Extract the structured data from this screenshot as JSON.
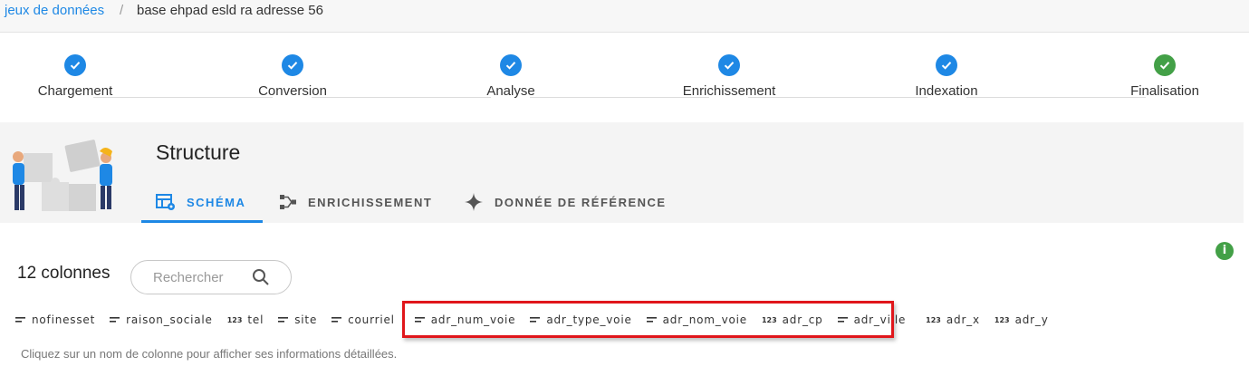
{
  "breadcrumb": {
    "link": "jeux de données",
    "separator": "/",
    "current": "base ehpad esld ra adresse 56"
  },
  "stepper": [
    {
      "label": "Chargement",
      "status": "done"
    },
    {
      "label": "Conversion",
      "status": "done"
    },
    {
      "label": "Analyse",
      "status": "done"
    },
    {
      "label": "Enrichissement",
      "status": "done"
    },
    {
      "label": "Indexation",
      "status": "done"
    },
    {
      "label": "Finalisation",
      "status": "done-final"
    }
  ],
  "header": {
    "title": "Structure",
    "tabs": [
      {
        "label": "SCHÉMA",
        "active": true,
        "icon": "table-cog-icon"
      },
      {
        "label": "ENRICHISSEMENT",
        "active": false,
        "icon": "merge-icon"
      },
      {
        "label": "DONNÉE DE RÉFÉRENCE",
        "active": false,
        "icon": "sparkle-icon"
      }
    ]
  },
  "info_icon": "i",
  "columns_section": {
    "count_label": "12 colonnes",
    "search_placeholder": "Rechercher",
    "columns": [
      {
        "name": "nofinesset",
        "type": "text"
      },
      {
        "name": "raison_sociale",
        "type": "text"
      },
      {
        "name": "tel",
        "type": "number",
        "type_label": "123"
      },
      {
        "name": "site",
        "type": "text"
      },
      {
        "name": "courriel",
        "type": "text"
      },
      {
        "name": "adr_num_voie",
        "type": "text"
      },
      {
        "name": "adr_type_voie",
        "type": "text"
      },
      {
        "name": "adr_nom_voie",
        "type": "text"
      },
      {
        "name": "adr_cp",
        "type": "number",
        "type_label": "123"
      },
      {
        "name": "adr_ville",
        "type": "text"
      },
      {
        "name": "adr_x",
        "type": "number",
        "type_label": "123"
      },
      {
        "name": "adr_y",
        "type": "number",
        "type_label": "123"
      }
    ],
    "hint": "Cliquez sur un nom de colonne pour afficher ses informations détaillées."
  },
  "colors": {
    "accent": "#1e88e5",
    "success": "#43a047",
    "highlight": "#e0161b"
  }
}
